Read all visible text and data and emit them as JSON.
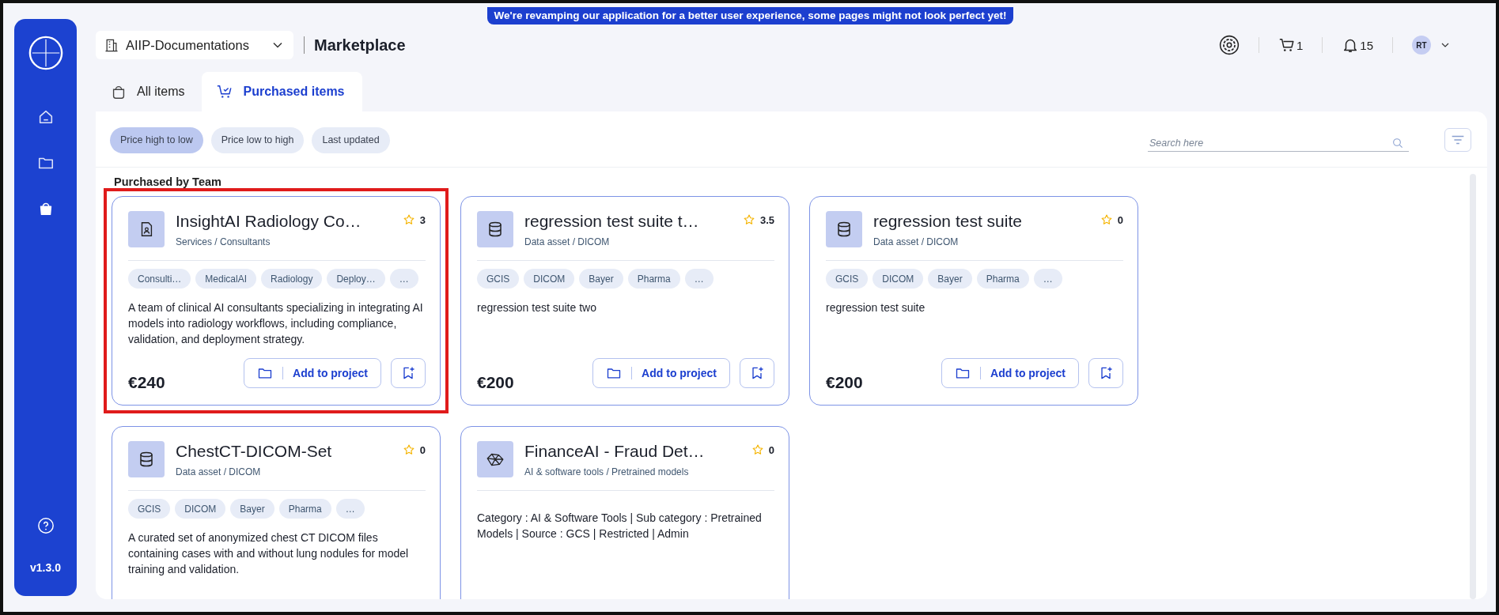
{
  "banner": "We're revamping our application for a better user experience, some pages might not look perfect yet!",
  "sidebar": {
    "items": [
      {
        "kind": "home",
        "selected": false
      },
      {
        "kind": "projects",
        "selected": false
      },
      {
        "kind": "marketplace",
        "selected": true
      }
    ],
    "version": "v1.3.0"
  },
  "header": {
    "workspace": "AIIP-Documentations",
    "title": "Marketplace",
    "cart_count": "1",
    "notification_count": "15",
    "avatar": "RT"
  },
  "tabs": [
    {
      "kind": "all",
      "label": "All items",
      "selected": false
    },
    {
      "kind": "purchased",
      "label": "Purchased items",
      "selected": true
    }
  ],
  "sort_options": [
    {
      "label": "Price high to low",
      "selected": true
    },
    {
      "label": "Price low to high",
      "selected": false
    },
    {
      "label": "Last updated",
      "selected": false
    }
  ],
  "search": {
    "placeholder": "Search here"
  },
  "section_title": "Purchased by Team",
  "cards": [
    {
      "kind": "service",
      "highlighted": true,
      "title": "InsightAI Radiology Co…",
      "rating": "3",
      "category": "Services / Consultants",
      "tags": [
        "Consulti…",
        "MedicalAI",
        "Radiology",
        "Deploy…",
        "…"
      ],
      "description": "A team of clinical AI consultants specializing in integrating AI models into radiology workflows, including compliance, validation, and deployment strategy.",
      "price": "€240",
      "action": "Add to project"
    },
    {
      "kind": "data",
      "highlighted": false,
      "title": "regression test suite t…",
      "rating": "3.5",
      "category": "Data asset / DICOM",
      "tags": [
        "GCIS",
        "DICOM",
        "Bayer",
        "Pharma",
        "…"
      ],
      "description": "regression test suite two",
      "price": "€200",
      "action": "Add to project"
    },
    {
      "kind": "data",
      "highlighted": false,
      "title": "regression test suite",
      "rating": "0",
      "category": "Data asset / DICOM",
      "tags": [
        "GCIS",
        "DICOM",
        "Bayer",
        "Pharma",
        "…"
      ],
      "description": "regression test suite",
      "price": "€200",
      "action": "Add to project"
    },
    {
      "kind": "data",
      "highlighted": false,
      "title": "ChestCT-DICOM-Set",
      "rating": "0",
      "category": "Data asset / DICOM",
      "tags": [
        "GCIS",
        "DICOM",
        "Bayer",
        "Pharma",
        "…"
      ],
      "description": "A curated set of anonymized chest CT DICOM files containing cases with and without lung nodules for model training and validation."
    },
    {
      "kind": "model",
      "highlighted": false,
      "title": "FinanceAI - Fraud Det…",
      "rating": "0",
      "category": "AI & software tools / Pretrained models",
      "description": "Category : AI & Software Tools | Sub category : Pretrained Models | Source : GCS | Restricted | Admin"
    }
  ]
}
